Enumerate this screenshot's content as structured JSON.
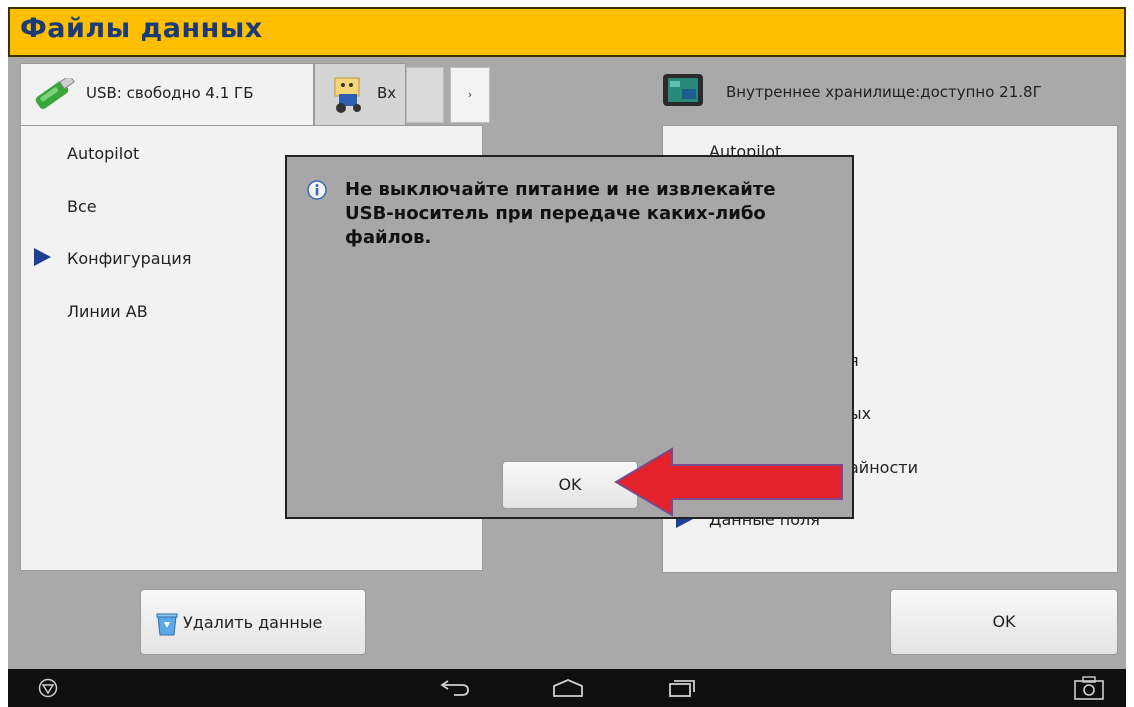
{
  "title": "Файлы данных",
  "left_tabs": {
    "usb_label": "USB: свободно 4.1 ГБ",
    "second_label": "Вх",
    "scroll_right_glyph": "›"
  },
  "left_list": [
    {
      "label": "Autopilot",
      "expanded": false
    },
    {
      "label": "Все",
      "expanded": false
    },
    {
      "label": "Конфигурация",
      "expanded": true
    },
    {
      "label": "Линии AB",
      "expanded": false
    }
  ],
  "right_header": {
    "label": "Внутреннее хранилище:доступно 21.8Г"
  },
  "right_list": {
    "item_0": "Autopilot",
    "item_partial_1": "я",
    "item_partial_2": "ых",
    "item_partial_3": "айности",
    "item_last": "Данные поля"
  },
  "buttons": {
    "delete_label": "Удалить данные",
    "ok_label": "OK"
  },
  "dialog": {
    "message": "Не выключайте питание и не извлекайте USB-носитель при передаче каких-либо файлов.",
    "ok_label": "OK"
  },
  "icons": [
    "usb-drive-icon",
    "tractor-folder-icon",
    "tablet-icon",
    "trash-icon",
    "info-icon",
    "power-icon",
    "back-icon",
    "home-icon",
    "recents-icon",
    "screenshot-icon"
  ],
  "colors": {
    "title_bar": "#fdbf00",
    "title_text": "#1b3a7a",
    "arrow": "#1d3f96",
    "highlight_arrow": "#e3222b"
  }
}
